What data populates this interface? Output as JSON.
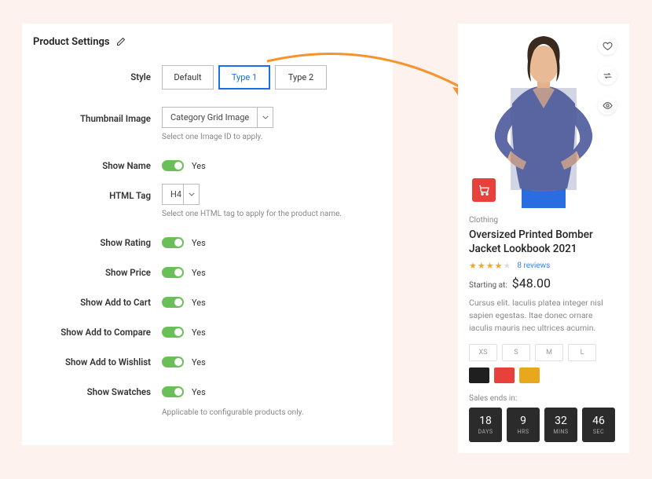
{
  "panel": {
    "title": "Product Settings",
    "style": {
      "label": "Style",
      "options": [
        "Default",
        "Type 1",
        "Type 2"
      ],
      "selected_index": 1
    },
    "thumbnail": {
      "label": "Thumbnail Image",
      "value": "Category Grid Image",
      "helper": "Select one Image ID to apply."
    },
    "show_name": {
      "label": "Show Name",
      "value": "Yes"
    },
    "html_tag": {
      "label": "HTML Tag",
      "value": "H4",
      "helper": "Select one HTML tag to apply for the product name."
    },
    "show_rating": {
      "label": "Show Rating",
      "value": "Yes"
    },
    "show_price": {
      "label": "Show Price",
      "value": "Yes"
    },
    "show_cart": {
      "label": "Show Add to Cart",
      "value": "Yes"
    },
    "show_compare": {
      "label": "Show Add to Compare",
      "value": "Yes"
    },
    "show_wishlist": {
      "label": "Show Add to Wishlist",
      "value": "Yes"
    },
    "show_swatches": {
      "label": "Show Swatches",
      "value": "Yes",
      "helper": "Applicable to configurable products only."
    }
  },
  "product": {
    "category": "Clothing",
    "title": "Oversized Printed Bomber Jacket Lookbook 2021",
    "rating": 4,
    "reviews_text": "8 reviews",
    "price_label": "Starting at:",
    "price": "$48.00",
    "description": "Cursus elit. Iaculis platea integer nisl sapien egestas. Itae donec ornare iaculis mauris nec ultrices acumin.",
    "sizes": [
      "XS",
      "S",
      "M",
      "L"
    ],
    "swatches": [
      "#1f1f1f",
      "#e8413c",
      "#e8a81c"
    ],
    "countdown_label": "Sales ends in:",
    "countdown": [
      {
        "num": "18",
        "unit": "DAYS"
      },
      {
        "num": "9",
        "unit": "HRS"
      },
      {
        "num": "32",
        "unit": "MINS"
      },
      {
        "num": "46",
        "unit": "SEC"
      }
    ]
  }
}
